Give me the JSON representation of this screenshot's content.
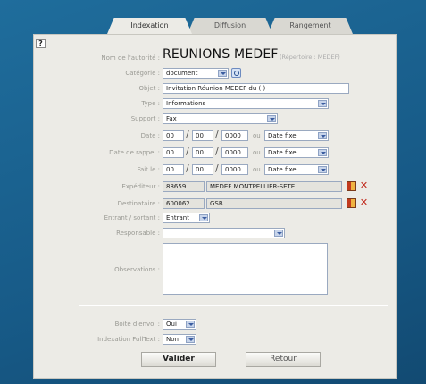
{
  "tabs": [
    "Indexation",
    "Diffusion",
    "Rangement"
  ],
  "help_label": "?",
  "nom": {
    "label": "Nom de l'autorité :",
    "value": "REUNIONS MEDEF",
    "repertoire": "(Répertoire : MEDEF)"
  },
  "categorie": {
    "label": "Catégorie :",
    "value": "document"
  },
  "objet": {
    "label": "Objet :",
    "value": "Invitation Réunion MEDEF du ( )"
  },
  "type": {
    "label": "Type :",
    "value": "Informations"
  },
  "support": {
    "label": "Support :",
    "value": "Fax"
  },
  "date": {
    "label": "Date :",
    "day": "00",
    "month": "00",
    "year": "0000",
    "ou": "ou",
    "option": "Date fixe"
  },
  "date_rappel": {
    "label": "Date de rappel :",
    "day": "00",
    "month": "00",
    "year": "0000",
    "ou": "ou",
    "option": "Date fixe"
  },
  "fait_le": {
    "label": "Fait le :",
    "day": "00",
    "month": "00",
    "year": "0000",
    "ou": "ou",
    "option": "Date fixe"
  },
  "expediteur": {
    "label": "Expéditeur :",
    "code": "88659",
    "name": "MEDEF MONTPELLIER-SETE"
  },
  "destinataire": {
    "label": "Destinataire :",
    "code": "600062",
    "name": "GSB"
  },
  "entrant": {
    "label": "Entrant / sortant :",
    "value": "Entrant"
  },
  "responsable": {
    "label": "Responsable :",
    "value": ""
  },
  "observations": {
    "label": "Observations :"
  },
  "boite": {
    "label": "Boite d'envoi :",
    "value": "Oui"
  },
  "fulltext": {
    "label": "Indexation FullText :",
    "value": "Non"
  },
  "buttons": {
    "valider": "Valider",
    "retour": "Retour"
  },
  "colors": {
    "background": "#1a5f8e",
    "panel": "#ecebe6",
    "field_border": "#9aa9c0",
    "delete": "#c0271a"
  }
}
